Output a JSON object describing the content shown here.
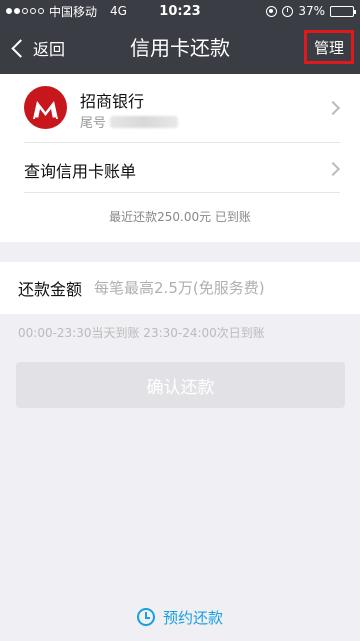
{
  "status_bar": {
    "carrier": "中国移动",
    "network": "4G",
    "time": "10:23",
    "battery": "37%",
    "battery_level": 0.37
  },
  "nav": {
    "back_label": "返回",
    "title": "信用卡还款",
    "manage_label": "管理"
  },
  "card": {
    "bank_name": "招商银行",
    "tail_label": "尾号",
    "query_bill_label": "查询信用卡账单",
    "recent_repayment": "最近还款250.00元 已到账"
  },
  "amount": {
    "label": "还款金额",
    "placeholder": "每笔最高2.5万(免服务费)"
  },
  "time_note": "00:00-23:30当天到账  23:30-24:00次日到账",
  "confirm_button": "确认还款",
  "schedule_link": "预约还款"
}
